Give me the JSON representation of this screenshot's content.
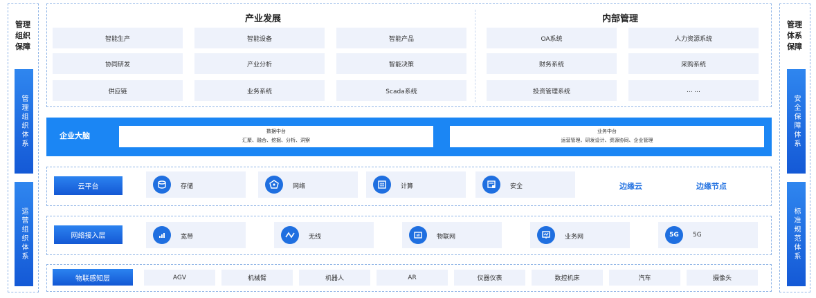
{
  "left": {
    "title_lines": [
      "管理",
      "组织",
      "保障"
    ],
    "bar_top": "管理组织体系",
    "bar_bottom": "运营组织体系"
  },
  "right": {
    "title_lines": [
      "管理",
      "体系",
      "保障"
    ],
    "bar_top": "安全保障体系",
    "bar_bottom": "标准规范体系"
  },
  "industry": {
    "title": "产业发展",
    "items": [
      "智能生产",
      "智能设备",
      "智能产品",
      "协同研发",
      "产业分析",
      "智能决策",
      "供应链",
      "业务系统",
      "Scada系统"
    ]
  },
  "internal": {
    "title": "内部管理",
    "items": [
      "OA系统",
      "人力资源系统",
      "财务系统",
      "采购系统",
      "投资管理系统",
      "... ..."
    ]
  },
  "brain": {
    "label": "企业大脑",
    "data_center": {
      "title": "数据中台",
      "desc": "汇聚、融合、挖掘、分析、洞察"
    },
    "biz_center": {
      "title": "业务中台",
      "desc": "运营管理、研发设计、资源协同、企业管理"
    }
  },
  "cloud": {
    "label": "云平台",
    "items": [
      {
        "label": "存储",
        "icon": "storage-icon"
      },
      {
        "label": "网络",
        "icon": "network-icon"
      },
      {
        "label": "计算",
        "icon": "compute-icon"
      },
      {
        "label": "安全",
        "icon": "security-icon"
      }
    ],
    "edge_cloud": "边缘云",
    "edge_node": "边缘节点"
  },
  "network": {
    "label": "网络接入层",
    "items": [
      {
        "label": "宽带",
        "icon": "broadband-icon"
      },
      {
        "label": "无线",
        "icon": "wireless-icon"
      },
      {
        "label": "物联网",
        "icon": "iot-icon"
      },
      {
        "label": "业务网",
        "icon": "business-network-icon"
      },
      {
        "label": "5G",
        "icon": "5g-icon",
        "glyph": "5G"
      }
    ]
  },
  "iot": {
    "label": "物联感知层",
    "items": [
      "AGV",
      "机械臂",
      "机器人",
      "AR",
      "仪器仪表",
      "数控机床",
      "汽车",
      "摄像头"
    ]
  },
  "colors": {
    "primary": "#1b86f4",
    "dark_blue": "#1458d4",
    "cell_bg": "#eef2fb",
    "dash": "#8fb4e6"
  }
}
